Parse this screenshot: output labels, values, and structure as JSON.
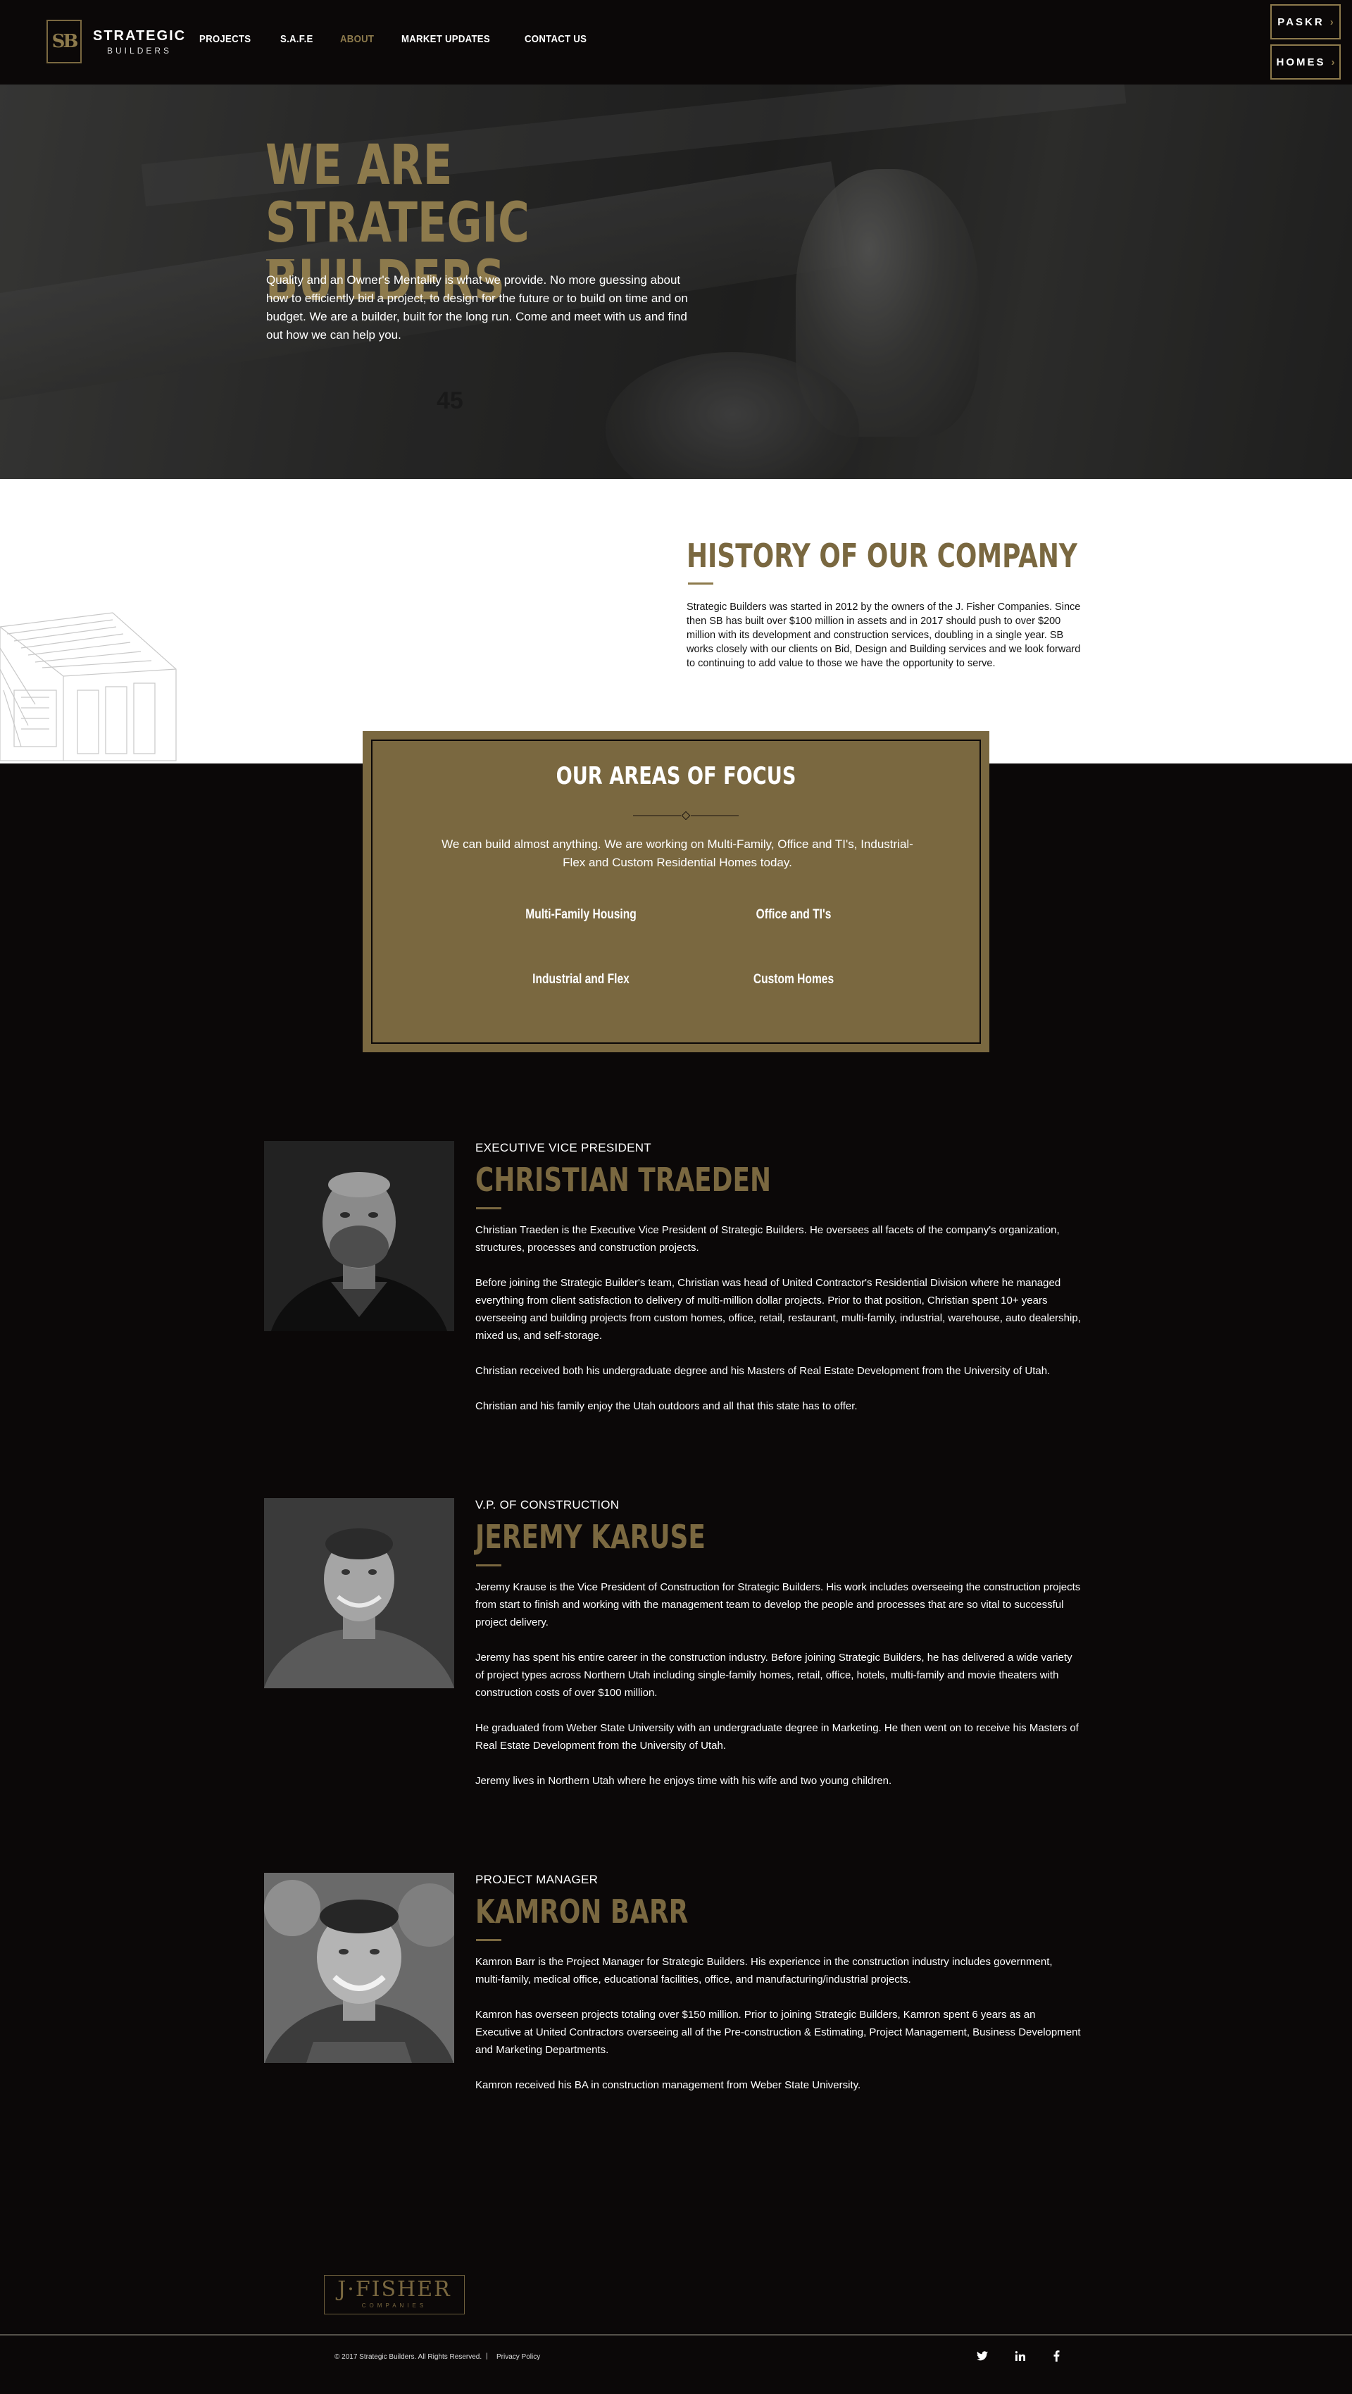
{
  "nav": {
    "logo_name": "STRATEGIC",
    "logo_sub": "BUILDERS",
    "logo_mark": "SB",
    "menu": [
      "PROJECTS",
      "S.A.F.E",
      "ABOUT",
      "MARKET UPDATES",
      "CONTACT US"
    ],
    "active": "ABOUT",
    "buttons": [
      "PASKR",
      "HOMES"
    ],
    "chevron": "›"
  },
  "hero": {
    "title": "WE ARE STRATEGIC BUILDERS",
    "text": "Quality and an Owner's Mentality is what we provide. No more guessing about how to efficiently bid a project, to design for the future or to build on time and on budget. We are a builder, built for the long run. Come and meet with us and find out how we can help you.",
    "image_number": "45"
  },
  "history": {
    "title": "HISTORY OF OUR COMPANY",
    "text": "Strategic Builders was started in 2012 by the owners of the J. Fisher Companies. Since then SB has built over $100 million in assets and in 2017 should push to over $200 million with its development and construction services, doubling in a single year. SB works closely with our clients on Bid, Design and Building services and we look forward to continuing to add value to those we have the opportunity to serve."
  },
  "focus": {
    "title": "OUR AREAS OF FOCUS",
    "description": "We can build almost anything. We are working on Multi-Family, Office and TI's, Industrial-Flex and Custom Residential Homes today.",
    "items": [
      "Multi-Family Housing",
      "Office and TI's",
      "Industrial and Flex",
      "Custom Homes"
    ]
  },
  "team": [
    {
      "role": "EXECUTIVE VICE PRESIDENT",
      "name": "CHRISTIAN TRAEDEN",
      "bio": [
        "Christian Traeden is the Executive Vice President of Strategic Builders. He oversees all facets of the company's organization, structures, processes and construction projects.",
        "Before joining the Strategic Builder's team, Christian was head of United Contractor's Residential Division where he managed everything from client satisfaction to delivery of multi-million dollar projects. Prior to that position, Christian spent 10+ years overseeing and building projects from custom homes, office, retail, restaurant, multi-family, industrial, warehouse, auto dealership, mixed us, and self-storage.",
        "Christian received both his undergraduate degree and his Masters of Real Estate Development from the University of Utah.",
        "Christian and his family enjoy the Utah outdoors and all that this state has to offer."
      ]
    },
    {
      "role": "V.P. OF CONSTRUCTION",
      "name": "JEREMY KARUSE",
      "bio": [
        "Jeremy Krause is the Vice President of Construction for Strategic Builders. His work includes overseeing the construction projects from start to finish and working with the management team to develop the people and processes that are so vital to successful project delivery.",
        "Jeremy has spent his entire career in the construction industry. Before joining Strategic Builders, he has delivered a wide variety of project types across Northern Utah including single-family homes, retail, office, hotels, multi-family and movie theaters with construction costs of over $100 million.",
        "He graduated from Weber State University with an undergraduate degree in Marketing. He then went on to receive his Masters of Real Estate Development from the University of Utah.",
        "Jeremy lives in Northern Utah where he enjoys time with his wife and two young children."
      ]
    },
    {
      "role": "PROJECT MANAGER",
      "name": "KAMRON BARR",
      "bio": [
        "Kamron Barr is the Project Manager for Strategic Builders. His experience in the construction industry includes government, multi-family, medical office, educational facilities, office, and manufacturing/industrial projects.",
        "Kamron has overseen projects totaling over $150 million. Prior to joining Strategic Builders, Kamron spent 6 years as an Executive at United Contractors overseeing all of the Pre-construction & Estimating, Project Management, Business Development and Marketing Departments.",
        "Kamron received his BA in construction management from Weber State University."
      ]
    }
  ],
  "footer": {
    "partner_name": "J·FISHER",
    "partner_sub": "COMPANIES",
    "copyright": "© 2017 Strategic Builders. All Rights Reserved.",
    "separator": "|",
    "privacy": "Privacy Policy",
    "social": [
      {
        "icon": "twitter-icon",
        "glyph": "t"
      },
      {
        "icon": "linkedin-icon",
        "glyph": "in"
      },
      {
        "icon": "facebook-icon",
        "glyph": "f"
      }
    ]
  },
  "colors": {
    "accent": "#8d7a4c",
    "background": "#0b0808",
    "focus_panel": "#7a6840"
  }
}
